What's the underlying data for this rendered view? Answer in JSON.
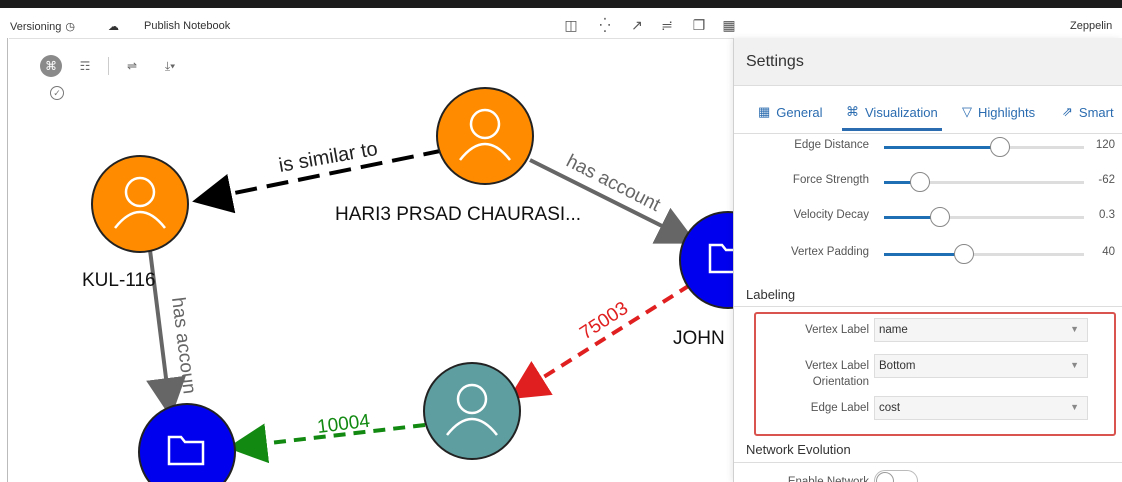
{
  "topbar": {
    "versioning": "Versioning",
    "publish": "Publish Notebook",
    "zeppelin": "Zeppelin"
  },
  "graph": {
    "nodes": {
      "hari": "HARI3 PRSAD CHAURASI...",
      "kul": "KUL-116",
      "john": "JOHN"
    },
    "edges": {
      "similar": "is similar to",
      "has_account_1": "has account",
      "has_account_2": "has accoun",
      "cost_1": "75003",
      "cost_2": "10004"
    }
  },
  "panel": {
    "title": "Settings",
    "tabs": [
      "General",
      "Visualization",
      "Highlights",
      "Smart"
    ],
    "sliders": [
      {
        "label": "Edge Distance",
        "value": "120",
        "fraction": 0.58
      },
      {
        "label": "Force Strength",
        "value": "-62",
        "fraction": 0.18
      },
      {
        "label": "Velocity Decay",
        "value": "0.3",
        "fraction": 0.28
      },
      {
        "label": "Vertex Padding",
        "value": "40",
        "fraction": 0.4
      }
    ],
    "labeling_title": "Labeling",
    "vertex_label": {
      "label": "Vertex Label",
      "value": "name"
    },
    "vertex_orientation": {
      "label": "Vertex Label Orientation",
      "value": "Bottom"
    },
    "edge_label": {
      "label": "Edge Label",
      "value": "cost"
    },
    "network_title": "Network Evolution",
    "enable_network": "Enable Network"
  },
  "colors": {
    "accent": "#1f6fb5",
    "orange_node": "#ff8c00",
    "blue_node": "#0000ee",
    "teal_node": "#5f9ea0",
    "highlight_box": "#d9534f"
  }
}
